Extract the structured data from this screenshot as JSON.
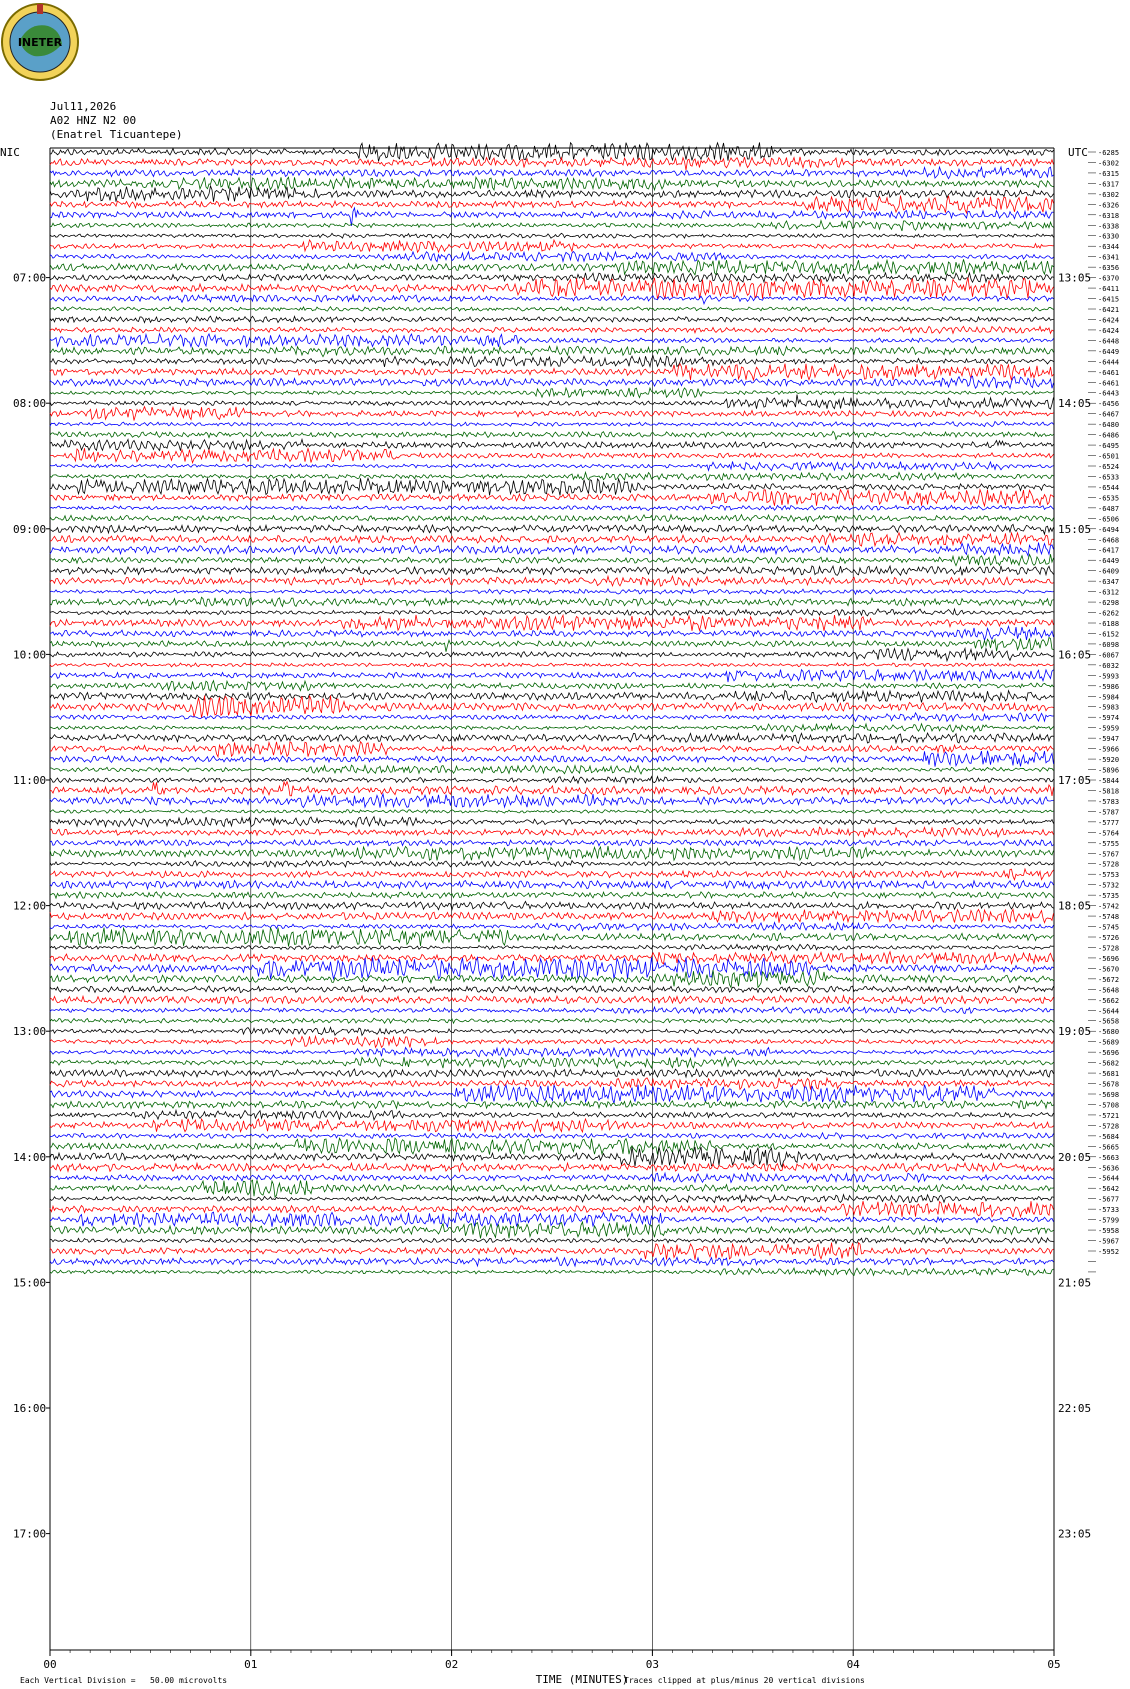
{
  "header": {
    "date": "Jul11,2026",
    "channel": "A02 HNZ N2 00",
    "station": "(Enatrel Ticuantepe)",
    "logo_text": "INETER",
    "left_zone": "NIC",
    "right_zone": "UTC"
  },
  "footer": {
    "scale_note": "Each Vertical Division =   50.00 microvolts",
    "xlabel": "TIME (MINUTES)",
    "clip_note": "Traces clipped at plus/minus 20 vertical divisions"
  },
  "colors": {
    "trace_cycle": [
      "#000000",
      "#ff0000",
      "#0000ff",
      "#006400"
    ],
    "grid": "#000000"
  },
  "chart_data": {
    "type": "line",
    "title": "",
    "xlabel": "TIME (MINUTES)",
    "ylabel": "",
    "xlim": [
      0,
      5
    ],
    "x_ticks": [
      "00",
      "01",
      "02",
      "03",
      "04",
      "05"
    ],
    "left_time_labels": [
      "07:00",
      "08:00",
      "09:00",
      "10:00",
      "11:00",
      "12:00",
      "13:00",
      "14:00",
      "15:00",
      "16:00",
      "17:00"
    ],
    "right_time_labels": [
      "13:05",
      "14:05",
      "15:05",
      "16:05",
      "17:05",
      "18:05",
      "19:05",
      "20:05",
      "21:05",
      "22:05",
      "23:05"
    ],
    "trace_count": 108,
    "traces_per_hour": 12,
    "trace_offsets": [
      "-6285",
      "-6302",
      "-6315",
      "-6317",
      "-6302",
      "-6326",
      "-6318",
      "-6338",
      "-6330",
      "-6344",
      "-6341",
      "-6356",
      "-6370",
      "-6411",
      "-6415",
      "-6421",
      "-6424",
      "-6424",
      "-6448",
      "-6449",
      "-6444",
      "-6461",
      "-6461",
      "-6443",
      "-6456",
      "-6467",
      "-6480",
      "-6486",
      "-6495",
      "-6501",
      "-6524",
      "-6533",
      "-6544",
      "-6535",
      "-6487",
      "-6506",
      "-6494",
      "-6468",
      "-6417",
      "-6449",
      "-6409",
      "-6347",
      "-6312",
      "-6298",
      "-6262",
      "-6188",
      "-6152",
      "-6098",
      "-6067",
      "-6032",
      "-5993",
      "-5986",
      "-5984",
      "-5983",
      "-5974",
      "-5959",
      "-5947",
      "-5966",
      "-5920",
      "-5896",
      "-5844",
      "-5818",
      "-5783",
      "-5787",
      "-5777",
      "-5764",
      "-5755",
      "-5767",
      "-5728",
      "-5753",
      "-5732",
      "-5735",
      "-5742",
      "-5748",
      "-5745",
      "-5726",
      "-5728",
      "-5696",
      "-5670",
      "-5672",
      "-5648",
      "-5662",
      "-5644",
      "-5658",
      "-5680",
      "-5689",
      "-5696",
      "-5682",
      "-5681",
      "-5678",
      "-5698",
      "-5708",
      "-5721",
      "-5728",
      "-5684",
      "-5665",
      "-5663",
      "-5636",
      "-5644",
      "-5642",
      "-5677",
      "-5733",
      "-5799",
      "-5958",
      "-5967",
      "-5952"
    ],
    "events": [
      {
        "trace": 1,
        "minute": 3.15,
        "amp": 10
      },
      {
        "trace": 6,
        "minute": 1.5,
        "amp": 9
      },
      {
        "trace": 7,
        "minute": 4.2,
        "amp": 9
      },
      {
        "trace": 14,
        "minute": 3.25,
        "amp": 8
      },
      {
        "trace": 19,
        "minute": 1.35,
        "amp": 6
      },
      {
        "trace": 24,
        "minute": 3.72,
        "amp": 9
      },
      {
        "trace": 27,
        "minute": 3.9,
        "amp": 8
      },
      {
        "trace": 28,
        "minute": 4.72,
        "amp": 7
      },
      {
        "trace": 47,
        "minute": 1.98,
        "amp": 7
      },
      {
        "trace": 57,
        "minute": 4.42,
        "amp": 8
      },
      {
        "trace": 61,
        "minute": 0.52,
        "amp": 14
      },
      {
        "trace": 61,
        "minute": 1.17,
        "amp": 14
      },
      {
        "trace": 61,
        "minute": 4.98,
        "amp": 10
      },
      {
        "trace": 64,
        "minute": 1.8,
        "amp": 5
      }
    ]
  }
}
